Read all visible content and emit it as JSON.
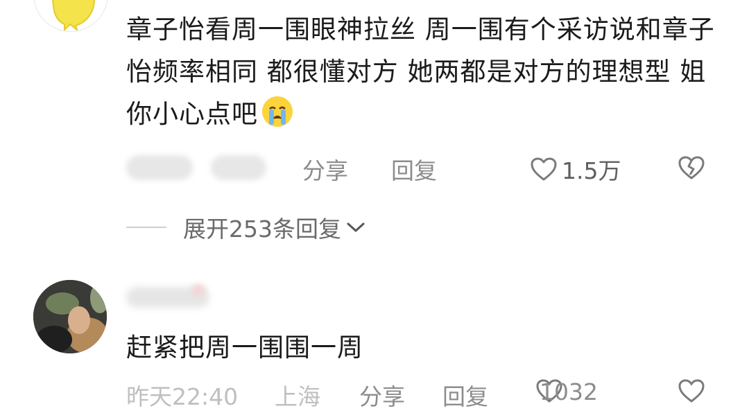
{
  "comments": [
    {
      "avatar_icon": "cartoon-yellow-avatar",
      "text": "章子怡看周一围眼神拉丝 周一围有个采访说和章子怡频率相同 都很懂对方 她两都是对方的理想型 姐你小心点吧",
      "emoji": "crying-face-emoji",
      "share_label": "分享",
      "reply_label": "回复",
      "like_count": "1.5万",
      "expand_label": "展开253条回复"
    },
    {
      "avatar_icon": "photo-avatar",
      "text": "赶紧把周一围围一周",
      "time": "昨天22:40",
      "location": "上海",
      "share_label": "分享",
      "reply_label": "回复",
      "like_count": "1032"
    }
  ],
  "colors": {
    "text": "#1b1b1b",
    "meta": "#8c8c8c",
    "accent_yellow": "#f7e64a"
  }
}
